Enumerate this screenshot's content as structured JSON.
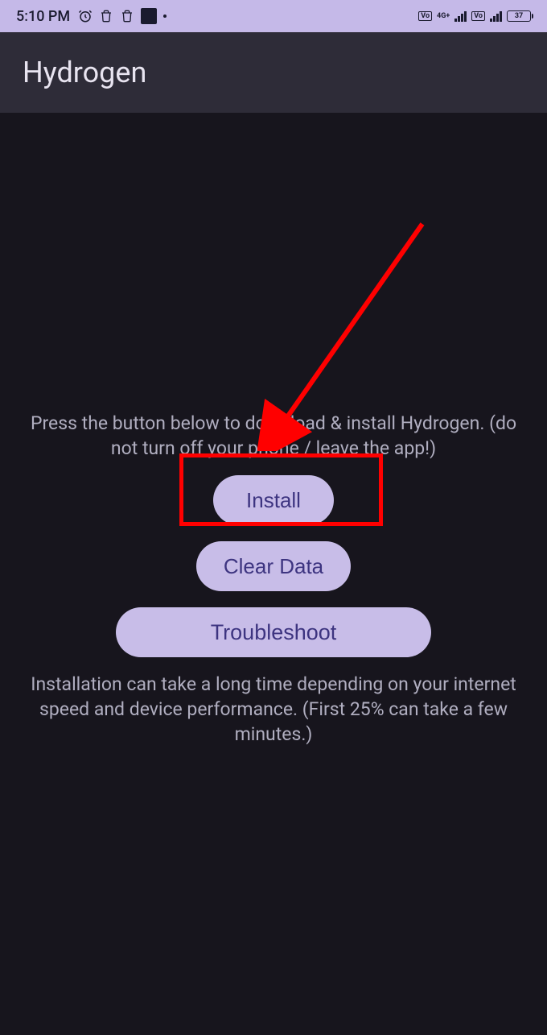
{
  "statusBar": {
    "time": "5:10 PM",
    "batteryLevel": "37"
  },
  "header": {
    "title": "Hydrogen"
  },
  "content": {
    "instructionTop": "Press the button below to download & install Hydrogen. (do not turn off your phone / leave the app!)",
    "installButton": "Install",
    "clearDataButton": "Clear Data",
    "troubleshootButton": "Troubleshoot",
    "instructionBottom": "Installation can take a long time depending on your internet speed and device performance. (First 25% can take a few minutes.)"
  }
}
